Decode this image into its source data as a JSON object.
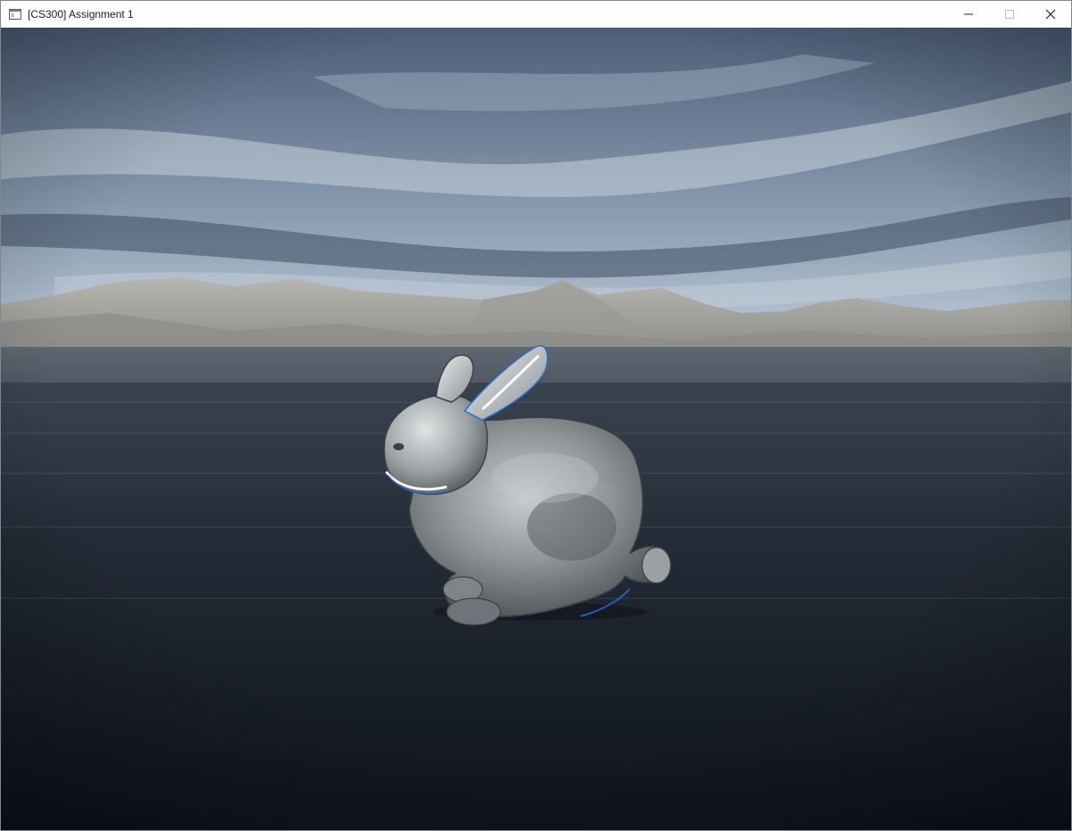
{
  "window": {
    "title": "[CS300] Assignment 1"
  },
  "title_bar": {
    "icon": "app-window-icon",
    "controls": [
      {
        "name": "minimize-icon",
        "label": "Minimize"
      },
      {
        "name": "maximize-icon",
        "label": "Maximize"
      },
      {
        "name": "close-icon",
        "label": "Close"
      }
    ]
  },
  "scene": {
    "subject": "bunny-model",
    "environment": "skybox-lake-mountains",
    "colors": {
      "sky_top": "#4d5e78",
      "sky_mid": "#7d90a6",
      "horizon": "#b6c4d2",
      "mountain": "#a9a9a4",
      "water_near": "#141a24",
      "water_far": "#3a4654",
      "bunny_base": "#9aa0a3",
      "bunny_highlight": "#eef2f4",
      "bunny_rim": "#2d6fc9"
    }
  }
}
